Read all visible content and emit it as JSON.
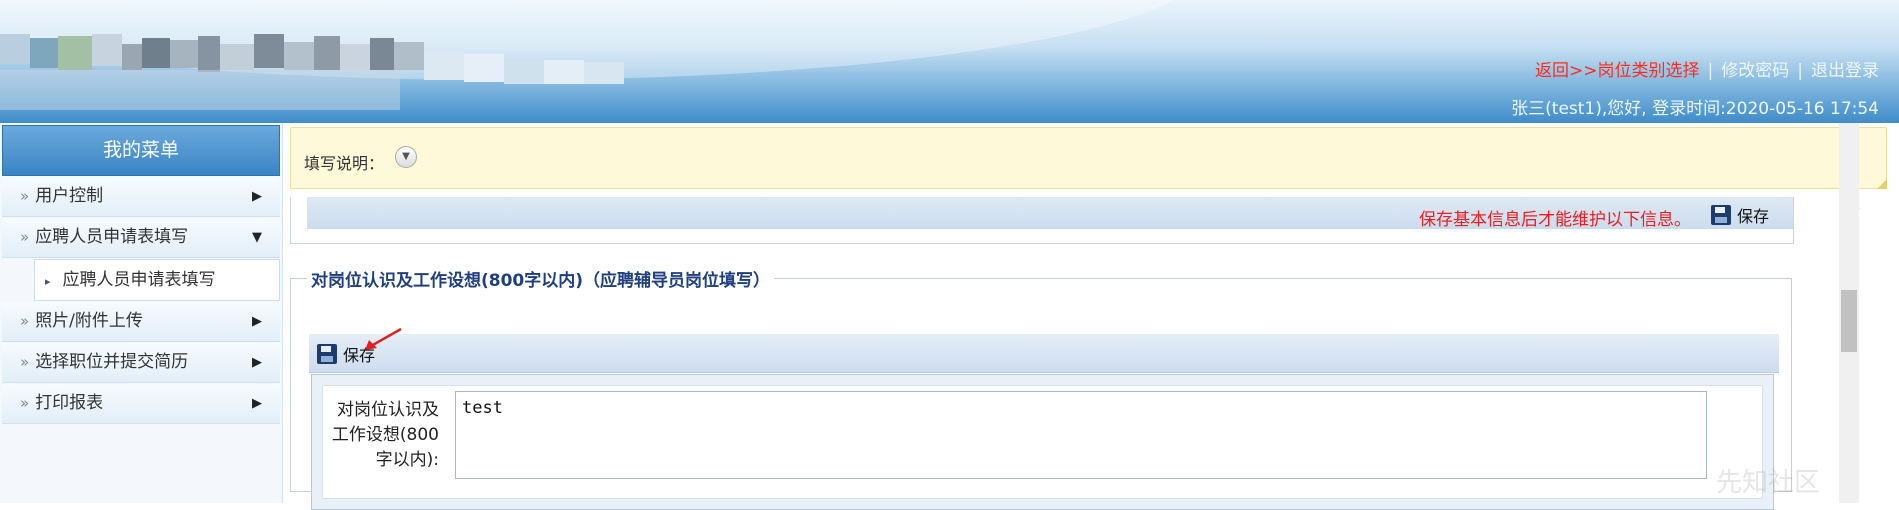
{
  "header": {
    "return_link": "返回>>岗位类别选择",
    "sep": "|",
    "change_password": "修改密码",
    "logout": "退出登录",
    "welcome": "张三(test1),您好, 登录时间:2020-05-16 17:54"
  },
  "sidebar": {
    "title": "我的菜单",
    "items": [
      {
        "label": "用户控制"
      },
      {
        "label": "应聘人员申请表填写"
      },
      {
        "label": "照片/附件上传"
      },
      {
        "label": "选择职位并提交简历"
      },
      {
        "label": "打印报表"
      }
    ],
    "submenu": {
      "label": "应聘人员申请表填写"
    }
  },
  "notice": {
    "label": "填写说明："
  },
  "panel": {
    "warning": "保存基本信息后才能维护以下信息。",
    "save_label": "保存"
  },
  "section": {
    "legend": "对岗位认识及工作设想(800字以内)（应聘辅导员岗位填写）",
    "save_label": "保存",
    "field_label": "对岗位认识及工作设想(800字以内):",
    "field_value": "test"
  },
  "watermark": "先知社区",
  "colors": {
    "accent": "#3a84c4",
    "warning": "#f21c1c",
    "legend": "#1f3f80"
  }
}
